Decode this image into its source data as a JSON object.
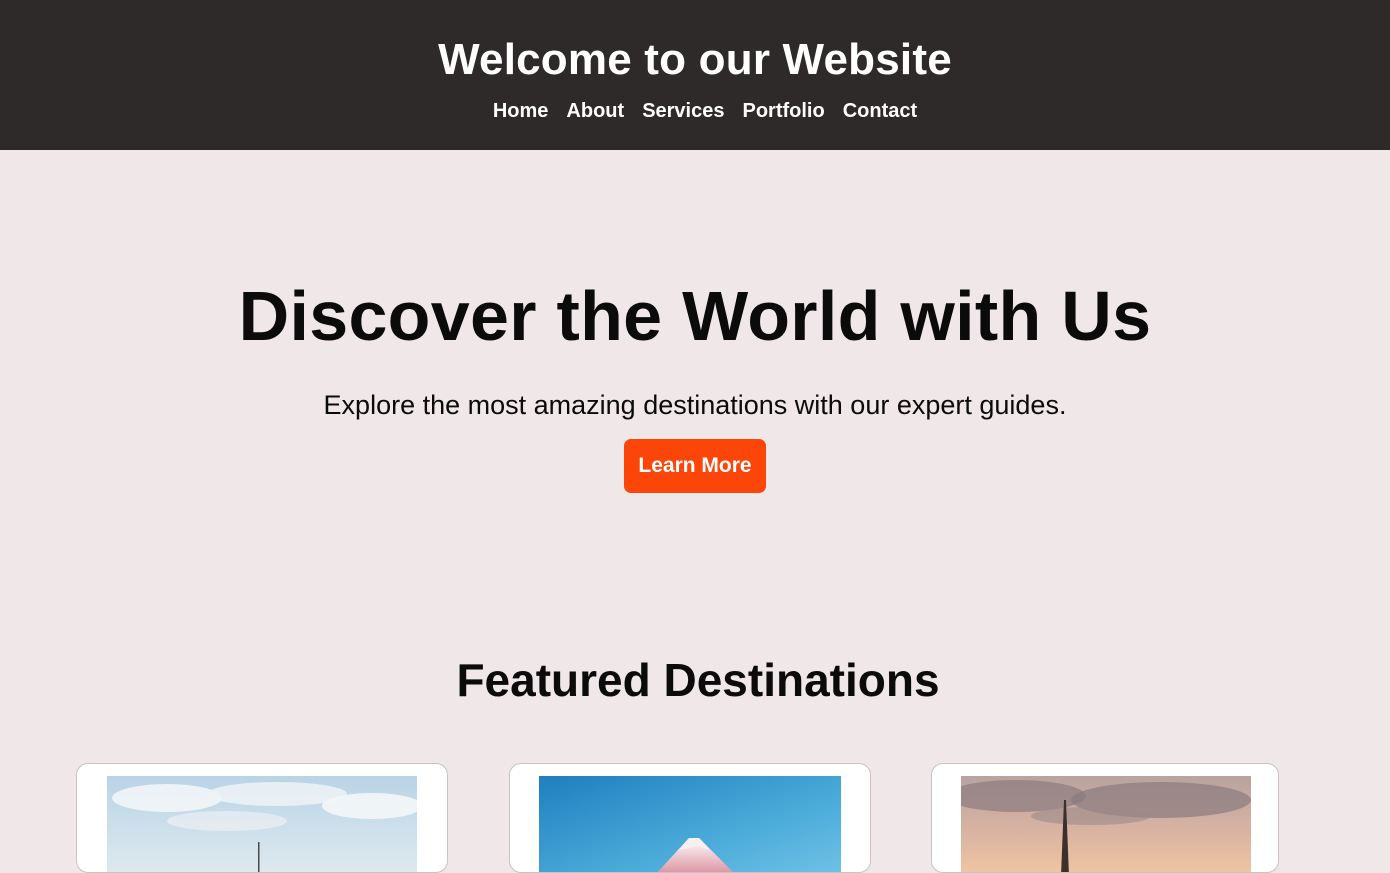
{
  "header": {
    "title": "Welcome to our Website",
    "nav": [
      "Home",
      "About",
      "Services",
      "Portfolio",
      "Contact"
    ]
  },
  "hero": {
    "title": "Discover the World with Us",
    "subtitle": "Explore the most amazing destinations with our expert guides.",
    "button_label": "Learn More"
  },
  "featured": {
    "title": "Featured Destinations",
    "cards": [
      {
        "image": "city-skyline-image"
      },
      {
        "image": "mountain-image"
      },
      {
        "image": "eiffel-tower-image"
      }
    ]
  },
  "colors": {
    "header_bg": "#2e2a29",
    "page_bg": "#efe7e8",
    "accent": "#fc4609",
    "text": "#0b0b0b"
  }
}
